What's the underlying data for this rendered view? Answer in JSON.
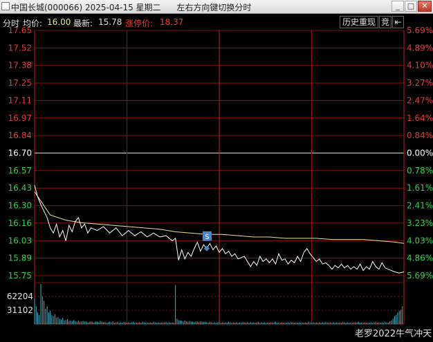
{
  "window": {
    "title": "中国长城(000066) 2025-04-15 星期二      左右方向键切换分时",
    "buttons": {
      "minimize": "_",
      "maximize": "□",
      "close": "✕"
    }
  },
  "info_bar": {
    "mode_label": "分时",
    "avg_label": "均价:",
    "avg_value": "16.00",
    "latest_label": "最新:",
    "latest_value": "15.78",
    "limit_label": "涨停价:",
    "limit_value": "18.37",
    "history_button": "历史重现",
    "auction_button": "竞",
    "pin_icon": "pin-icon"
  },
  "colors": {
    "up": "#e53a3a",
    "down": "#2bd24b",
    "price_line": "#ffffff",
    "avg_line": "#e8e29a",
    "volume": "#3fb6c8",
    "grid": "#8a1010",
    "marker": "#4a86c8"
  },
  "chart_data": {
    "type": "line",
    "prev_close": 16.7,
    "price_ticks": [
      "17.65",
      "17.52",
      "17.38",
      "17.25",
      "17.11",
      "16.97",
      "16.84",
      "16.70",
      "16.57",
      "16.43",
      "16.30",
      "16.16",
      "16.03",
      "15.89",
      "15.75"
    ],
    "pct_ticks": [
      "5.69%",
      "4.89%",
      "4.10%",
      "3.27%",
      "2.47%",
      "1.64%",
      "0.84%",
      "0.00%",
      "0.78%",
      "1.61%",
      "2.41%",
      "3.23%",
      "4.03%",
      "4.86%",
      "5.69%"
    ],
    "ylim": [
      15.75,
      17.65
    ],
    "volume_ticks": [
      "62204",
      "31102"
    ],
    "volume_max": 93306,
    "marker_label": "S",
    "marker_time_index": 110,
    "price": [
      [
        0,
        16.45
      ],
      [
        2,
        16.36
      ],
      [
        4,
        16.3
      ],
      [
        6,
        16.25
      ],
      [
        8,
        16.2
      ],
      [
        10,
        16.12
      ],
      [
        12,
        16.08
      ],
      [
        14,
        16.15
      ],
      [
        16,
        16.05
      ],
      [
        18,
        16.1
      ],
      [
        20,
        16.02
      ],
      [
        22,
        16.14
      ],
      [
        24,
        16.09
      ],
      [
        26,
        16.17
      ],
      [
        28,
        16.2
      ],
      [
        30,
        16.12
      ],
      [
        32,
        16.15
      ],
      [
        34,
        16.08
      ],
      [
        36,
        16.12
      ],
      [
        40,
        16.1
      ],
      [
        44,
        16.13
      ],
      [
        48,
        16.08
      ],
      [
        52,
        16.12
      ],
      [
        56,
        16.06
      ],
      [
        60,
        16.1
      ],
      [
        64,
        16.06
      ],
      [
        68,
        16.09
      ],
      [
        72,
        16.05
      ],
      [
        76,
        16.08
      ],
      [
        80,
        16.05
      ],
      [
        84,
        16.06
      ],
      [
        88,
        16.02
      ],
      [
        90,
        16.04
      ],
      [
        92,
        15.87
      ],
      [
        94,
        15.95
      ],
      [
        96,
        15.88
      ],
      [
        98,
        15.93
      ],
      [
        100,
        15.9
      ],
      [
        102,
        15.96
      ],
      [
        104,
        16.01
      ],
      [
        106,
        15.94
      ],
      [
        108,
        15.99
      ],
      [
        110,
        15.96
      ],
      [
        112,
        16.0
      ],
      [
        114,
        15.95
      ],
      [
        116,
        15.98
      ],
      [
        118,
        15.93
      ],
      [
        120,
        15.96
      ],
      [
        122,
        15.92
      ],
      [
        124,
        15.94
      ],
      [
        126,
        15.9
      ],
      [
        128,
        15.92
      ],
      [
        130,
        15.88
      ],
      [
        134,
        15.9
      ],
      [
        138,
        15.82
      ],
      [
        140,
        15.86
      ],
      [
        142,
        15.83
      ],
      [
        144,
        15.9
      ],
      [
        146,
        15.86
      ],
      [
        148,
        15.88
      ],
      [
        150,
        15.85
      ],
      [
        152,
        15.88
      ],
      [
        154,
        15.84
      ],
      [
        156,
        15.92
      ],
      [
        158,
        15.87
      ],
      [
        160,
        15.88
      ],
      [
        162,
        15.84
      ],
      [
        164,
        15.87
      ],
      [
        166,
        15.85
      ],
      [
        168,
        15.9
      ],
      [
        170,
        15.86
      ],
      [
        172,
        15.93
      ],
      [
        174,
        15.96
      ],
      [
        176,
        15.92
      ],
      [
        178,
        15.89
      ],
      [
        180,
        15.86
      ],
      [
        182,
        15.88
      ],
      [
        184,
        15.84
      ],
      [
        186,
        15.85
      ],
      [
        188,
        15.83
      ],
      [
        190,
        15.8
      ],
      [
        192,
        15.83
      ],
      [
        194,
        15.81
      ],
      [
        196,
        15.84
      ],
      [
        198,
        15.81
      ],
      [
        200,
        15.83
      ],
      [
        202,
        15.8
      ],
      [
        204,
        15.82
      ],
      [
        206,
        15.8
      ],
      [
        208,
        15.84
      ],
      [
        210,
        15.79
      ],
      [
        212,
        15.82
      ],
      [
        214,
        15.8
      ],
      [
        216,
        15.86
      ],
      [
        218,
        15.82
      ],
      [
        220,
        15.8
      ],
      [
        222,
        15.85
      ],
      [
        224,
        15.81
      ],
      [
        226,
        15.8
      ],
      [
        228,
        15.79
      ],
      [
        230,
        15.78
      ],
      [
        233,
        15.77
      ],
      [
        236,
        15.78
      ]
    ],
    "avg": [
      [
        0,
        16.4
      ],
      [
        10,
        16.22
      ],
      [
        20,
        16.18
      ],
      [
        30,
        16.16
      ],
      [
        40,
        16.15
      ],
      [
        50,
        16.14
      ],
      [
        60,
        16.13
      ],
      [
        70,
        16.12
      ],
      [
        80,
        16.11
      ],
      [
        90,
        16.09
      ],
      [
        100,
        16.08
      ],
      [
        110,
        16.07
      ],
      [
        120,
        16.07
      ],
      [
        130,
        16.06
      ],
      [
        140,
        16.05
      ],
      [
        150,
        16.05
      ],
      [
        160,
        16.04
      ],
      [
        170,
        16.04
      ],
      [
        180,
        16.04
      ],
      [
        190,
        16.03
      ],
      [
        200,
        16.03
      ],
      [
        210,
        16.03
      ],
      [
        220,
        16.02
      ],
      [
        230,
        16.01
      ],
      [
        236,
        16.0
      ]
    ],
    "volume": [
      58000,
      40000,
      26000,
      20000,
      90000,
      62000,
      52000,
      34000,
      40000,
      26000,
      30000,
      20000,
      18000,
      22000,
      14000,
      16000,
      12000,
      10000,
      14000,
      8000,
      9000,
      11000,
      7000,
      8000,
      6000,
      9000,
      7000,
      6000,
      8000,
      5000,
      6000,
      7000,
      5000,
      6000,
      4000,
      5000,
      6000,
      5000,
      4000,
      6000,
      5000,
      4000,
      7000,
      5000,
      4000,
      5000,
      3000,
      4000,
      5000,
      4000,
      6000,
      3000,
      4000,
      5000,
      3000,
      4000,
      3000,
      5000,
      4000,
      3000,
      4000,
      3000,
      4000,
      5000,
      3000,
      4000,
      3000,
      4000,
      3000,
      5000,
      4000,
      3000,
      4000,
      3000,
      4000,
      3000,
      5000,
      4000,
      3000,
      4000,
      3000,
      4000,
      3000,
      4000,
      5000,
      3000,
      4000,
      3000,
      4000,
      3000,
      88000,
      12000,
      9000,
      8000,
      7000,
      6000,
      8000,
      6000,
      5000,
      7000,
      6000,
      5000,
      4000,
      6000,
      5000,
      4000,
      6000,
      5000,
      4000,
      5000,
      4000,
      3000,
      5000,
      4000,
      3000,
      4000,
      3000,
      4000,
      5000,
      3000,
      4000,
      3000,
      4000,
      3000,
      5000,
      4000,
      3000,
      4000,
      3000,
      4000,
      3000,
      4000,
      3000,
      5000,
      4000,
      3000,
      4000,
      3000,
      4000,
      3000,
      4000,
      3000,
      4000,
      5000,
      3000,
      4000,
      3000,
      4000,
      3000,
      4000,
      3000,
      4000,
      3000,
      4000,
      5000,
      3000,
      4000,
      3000,
      4000,
      3000,
      4000,
      3000,
      4000,
      3000,
      5000,
      4000,
      3000,
      4000,
      3000,
      4000,
      3000,
      4000,
      3000,
      4000,
      3000,
      5000,
      4000,
      3000,
      4000,
      3000,
      4000,
      3000,
      4000,
      3000,
      4000,
      3000,
      5000,
      4000,
      3000,
      4000,
      3000,
      4000,
      3000,
      4000,
      3000,
      4000,
      3000,
      5000,
      4000,
      3000,
      4000,
      3000,
      4000,
      3000,
      4000,
      3000,
      4000,
      5000,
      3000,
      4000,
      3000,
      4000,
      3000,
      4000,
      3000,
      4000,
      3000,
      4000,
      5000,
      3000,
      4000,
      3000,
      4000,
      3000,
      5000,
      4000,
      3000,
      6000,
      8000,
      12000,
      18000,
      20000,
      26000,
      30000,
      32000,
      40000
    ]
  },
  "watermark": "老罗2022牛气冲天"
}
